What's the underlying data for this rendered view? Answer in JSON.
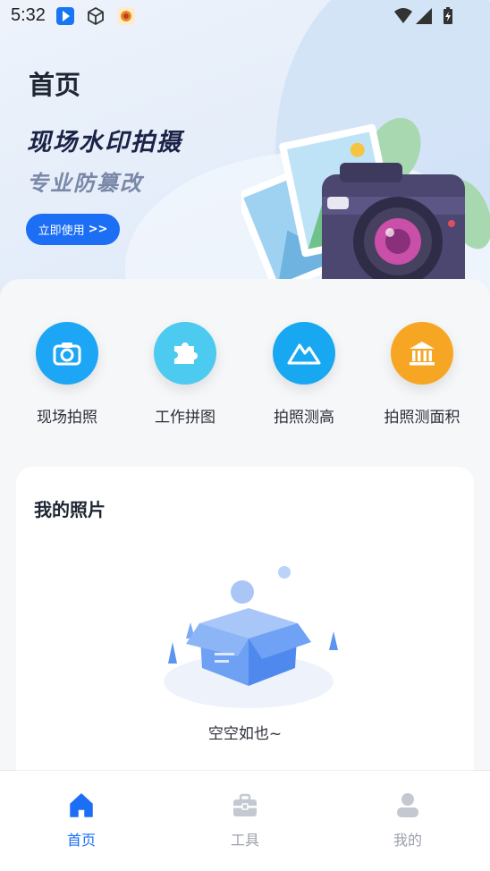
{
  "status_bar": {
    "time": "5:32"
  },
  "header": {
    "title": "首页"
  },
  "banner": {
    "title": "现场水印拍摄",
    "subtitle": "专业防篡改",
    "button_label": "立即使用",
    "button_arrows": ">>"
  },
  "quick_actions": [
    {
      "label": "现场拍照",
      "icon": "camera-icon",
      "color": "#1da6f5"
    },
    {
      "label": "工作拼图",
      "icon": "puzzle-icon",
      "color": "#4ccaf0"
    },
    {
      "label": "拍照测高",
      "icon": "mountain-icon",
      "color": "#18a8f2"
    },
    {
      "label": "拍照测面积",
      "icon": "bank-icon",
      "color": "#f6a623"
    }
  ],
  "photos_section": {
    "title": "我的照片",
    "empty_text": "空空如也~"
  },
  "tabbar": {
    "items": [
      {
        "label": "首页",
        "icon": "home-icon",
        "active": true
      },
      {
        "label": "工具",
        "icon": "toolbox-icon",
        "active": false
      },
      {
        "label": "我的",
        "icon": "user-icon",
        "active": false
      }
    ],
    "active_color": "#1c6ff5",
    "inactive_color": "#9aa0aa"
  }
}
